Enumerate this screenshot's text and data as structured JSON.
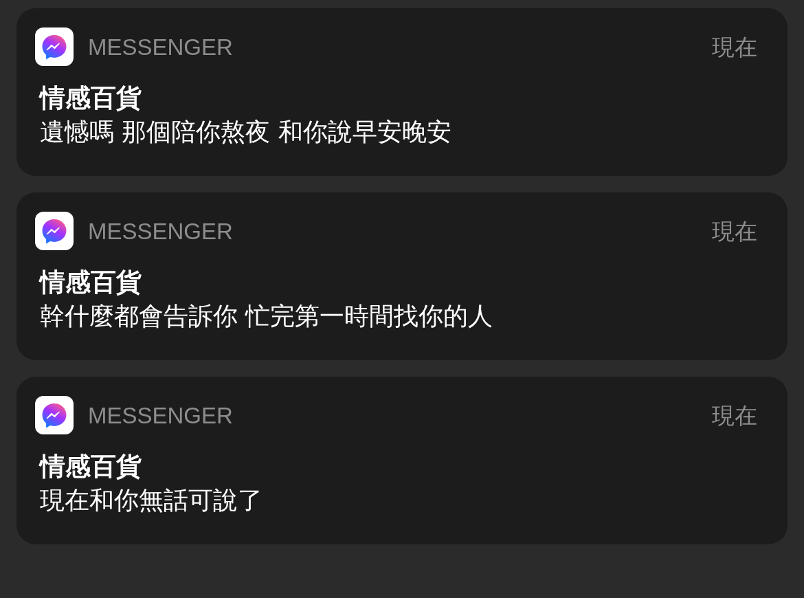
{
  "notifications": [
    {
      "app": "MESSENGER",
      "time": "現在",
      "title": "情感百貨",
      "message": "遺憾嗎 那個陪你熬夜 和你說早安晚安"
    },
    {
      "app": "MESSENGER",
      "time": "現在",
      "title": "情感百貨",
      "message": "幹什麼都會告訴你 忙完第一時間找你的人"
    },
    {
      "app": "MESSENGER",
      "time": "現在",
      "title": "情感百貨",
      "message": "現在和你無話可說了"
    }
  ]
}
